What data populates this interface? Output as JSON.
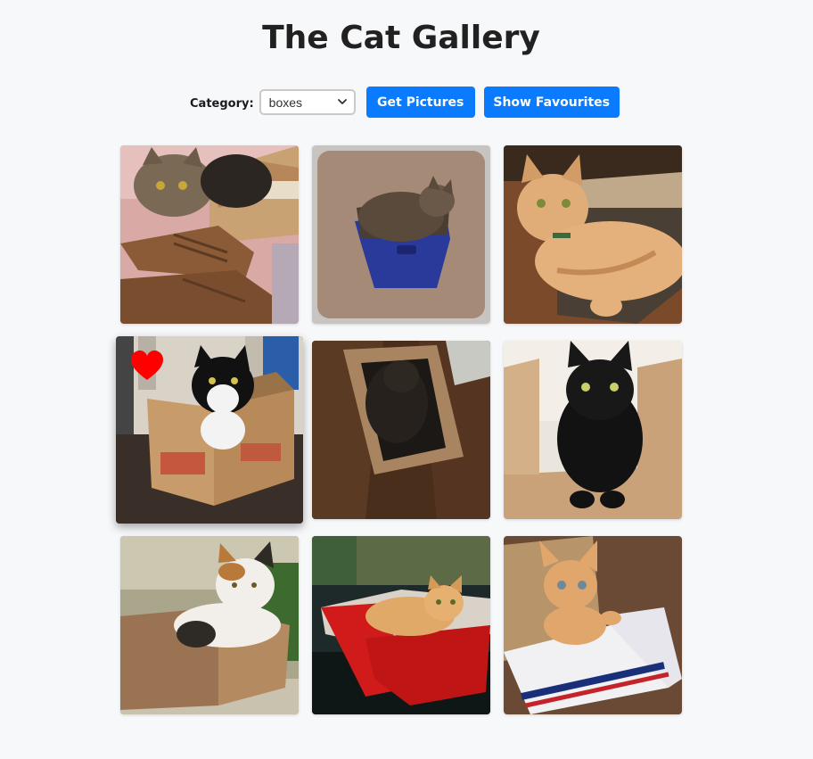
{
  "page": {
    "title": "The Cat Gallery"
  },
  "controls": {
    "category_label": "Category:",
    "category_value": "boxes",
    "get_button": "Get Pictures",
    "favourites_button": "Show Favourites",
    "accent_color": "#0a7bff"
  },
  "gallery": {
    "images": [
      {
        "alt": "",
        "favourite": false
      },
      {
        "alt": "",
        "favourite": false
      },
      {
        "alt": "",
        "favourite": false
      },
      {
        "alt": "",
        "favourite": true
      },
      {
        "alt": "",
        "favourite": false
      },
      {
        "alt": "",
        "favourite": false
      },
      {
        "alt": "",
        "favourite": false
      },
      {
        "alt": "",
        "favourite": false
      },
      {
        "alt": "",
        "favourite": false
      }
    ],
    "favourite_icon": "heart-icon",
    "favourite_color": "#ff0000"
  }
}
